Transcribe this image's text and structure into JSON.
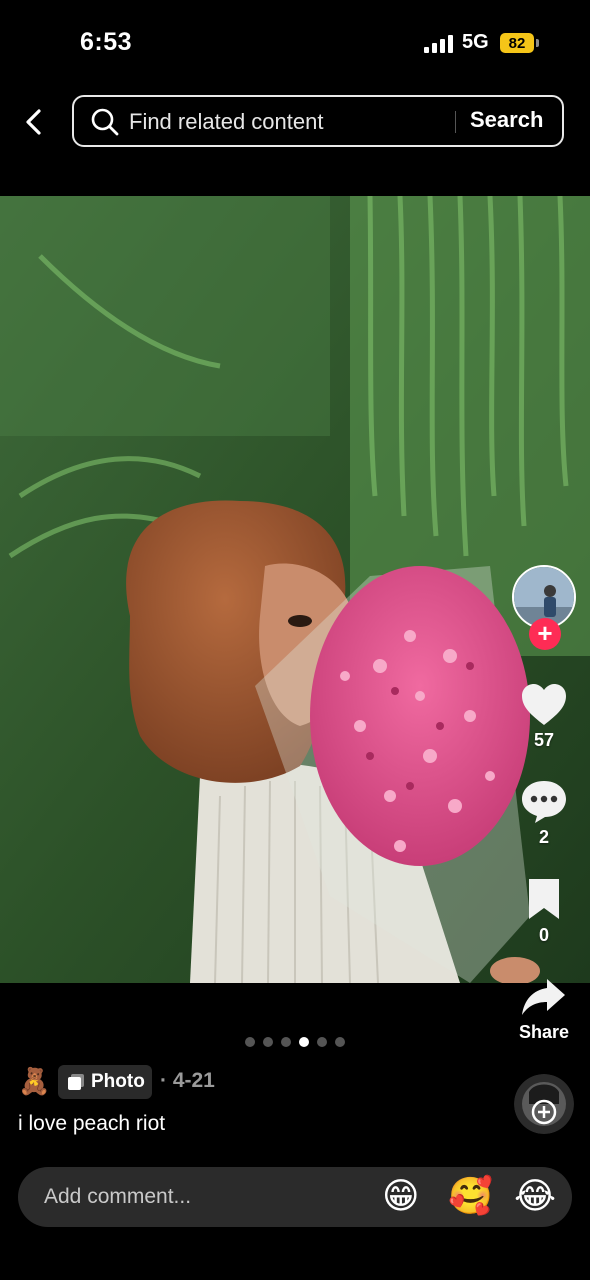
{
  "status": {
    "time": "6:53",
    "network": "5G",
    "battery": "82"
  },
  "search": {
    "placeholder": "Find related content",
    "button": "Search"
  },
  "rail": {
    "follow": "+",
    "likes": "57",
    "comments": "2",
    "bookmarks": "0",
    "share": "Share"
  },
  "carousel": {
    "count": 6,
    "active_index": 3
  },
  "post": {
    "emoji": "🧸",
    "tag": "Photo",
    "date": "· 4-21",
    "caption": "i love peach riot"
  },
  "comment": {
    "placeholder": "Add comment...",
    "emojis": [
      "😁",
      "🥰",
      "😂"
    ]
  },
  "colors": {
    "accent": "#fe2c55",
    "battery": "#f5c518"
  },
  "icons": {
    "back": "chevron-left-icon",
    "search": "search-icon",
    "like": "heart-icon",
    "comment": "comment-bubble-icon",
    "bookmark": "bookmark-icon",
    "share": "share-arrow-icon"
  }
}
